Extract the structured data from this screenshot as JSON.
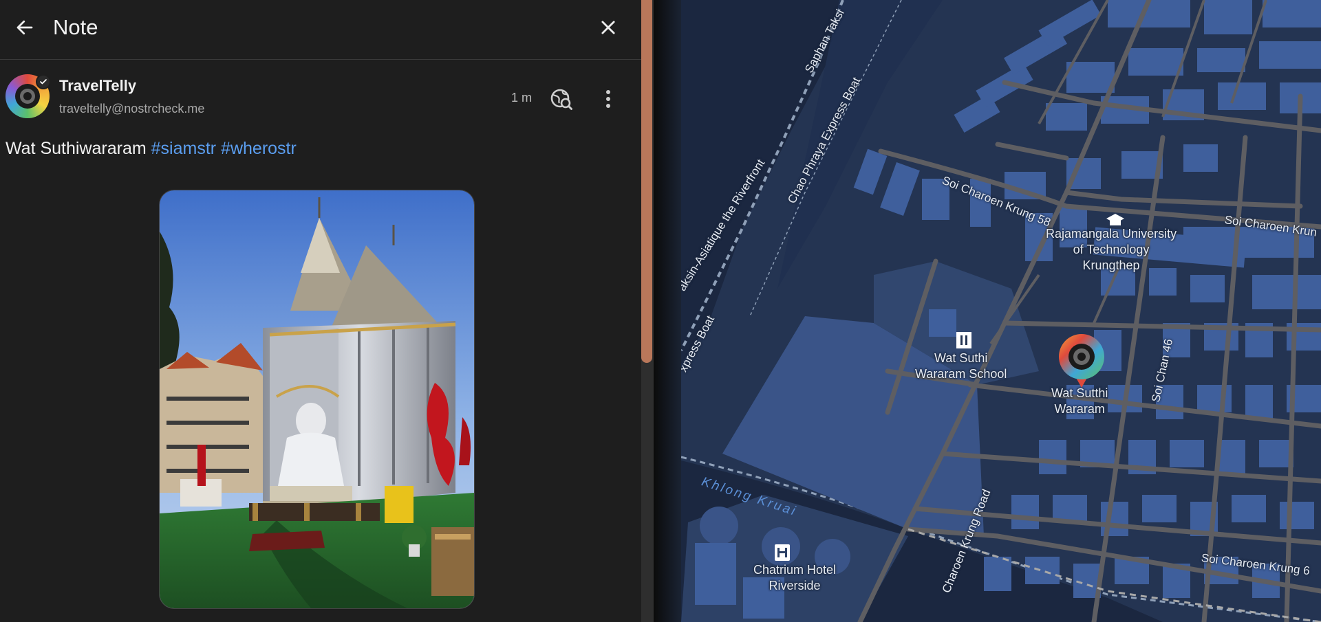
{
  "header": {
    "title": "Note"
  },
  "note": {
    "author_name": "TravelTelly",
    "author_handle": "traveltelly@nostrcheck.me",
    "time": "1 m",
    "text": "Wat Suthiwararam",
    "hashtags": [
      "#siamstr",
      "#wherostr"
    ]
  },
  "map": {
    "places": {
      "school": "Wat Suthi\nWararam School",
      "temple": "Wat Sutthi\nWararam",
      "university": "Rajamangala University\nof Technology\nKrungthep",
      "hotel": "Chatrium Hotel\nRiverside"
    },
    "roads": {
      "saphan_taksin": "Saphan Taksi",
      "express_boat_1": "Chao Phraya Express Boat",
      "asiatique": "aksin-Asiatique the Riverfront",
      "express_boat_2": "xpress Boat",
      "soi_58": "Soi Charoen Krung 58",
      "soi_east": "Soi Charoen Krun",
      "soi_chan": "Soi Chan 46",
      "charoen_krung": "Charoen Krung Road",
      "soi_69": "Soi Charoen Krung 6"
    },
    "water": {
      "khlong": "Khlong Kruai"
    }
  },
  "colors": {
    "panel_bg": "#1e1e1e",
    "accent_link": "#5b9ef0",
    "scroll_thumb": "#b9775a",
    "map_land": "#243452",
    "map_building": "#3f5f9c",
    "map_road": "#5e5e62"
  },
  "icons": {
    "back": "arrow-left-icon",
    "close": "close-icon",
    "search_globe": "globe-search-icon",
    "more": "more-vertical-icon",
    "verified": "check-badge-icon"
  }
}
